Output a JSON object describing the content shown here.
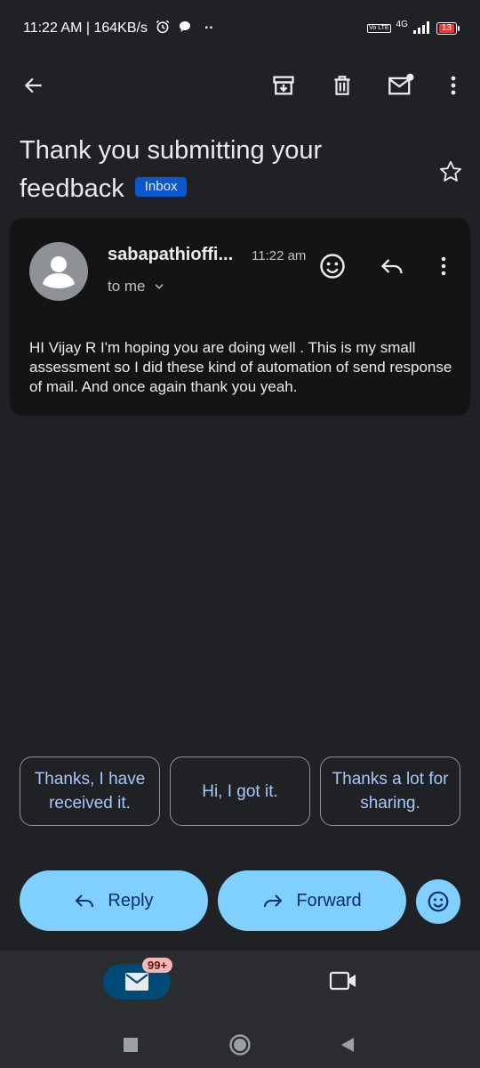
{
  "status_bar": {
    "time_speed": "11:22 AM | 164KB/s",
    "more_dots": "··",
    "network": "4G",
    "volte": "Vo LTE",
    "battery": "13"
  },
  "email": {
    "subject": "Thank you submitting your feedback",
    "label": "Inbox",
    "sender": "sabapathioffi...",
    "time": "11:22 am",
    "recipient": "to me",
    "body": "HI Vijay R I'm hoping you are doing well . This is my small assessment so I did these kind of automation of send response of mail. And once again thank you yeah."
  },
  "smart_replies": [
    "Thanks, I have received it.",
    "Hi, I got it.",
    "Thanks a lot for sharing."
  ],
  "actions": {
    "reply": "Reply",
    "forward": "Forward"
  },
  "bottom_nav": {
    "mail_badge": "99+"
  },
  "colors": {
    "background": "#202124",
    "card": "#141414",
    "accent_button": "#7fcfff",
    "inbox_badge": "#0b57d0",
    "chip_text": "#a8c7fa"
  }
}
